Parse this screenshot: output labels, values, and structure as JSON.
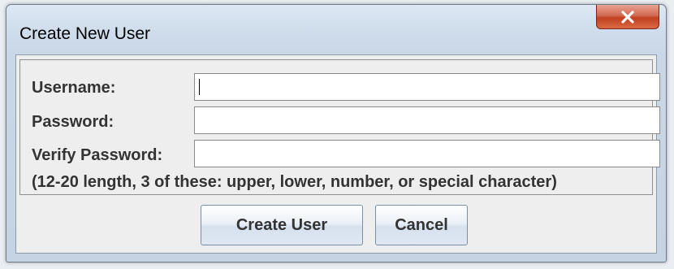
{
  "window": {
    "title": "Create New User",
    "close_icon": "close-x-icon",
    "accent_close_color": "#c8482a"
  },
  "form": {
    "username_label": "Username:",
    "username_value": "",
    "password_label": "Password:",
    "password_value": "",
    "verify_label": "Verify Password:",
    "verify_value": "",
    "hint": "(12-20 length, 3 of these: upper, lower, number, or special character)"
  },
  "buttons": {
    "create_label": "Create User",
    "cancel_label": "Cancel"
  }
}
